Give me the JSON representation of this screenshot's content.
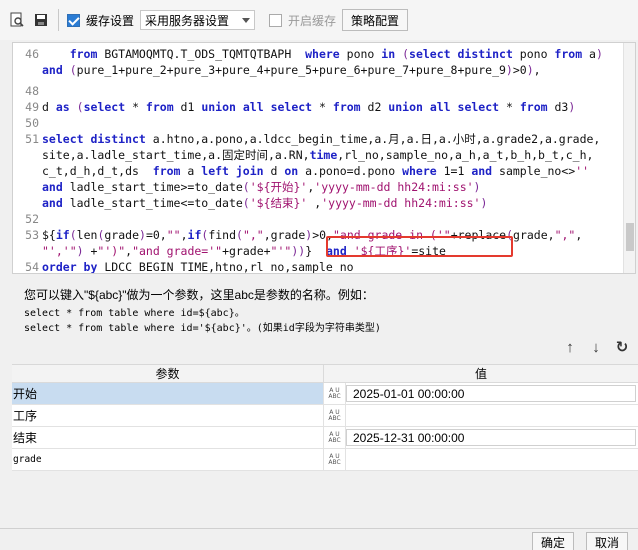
{
  "toolbar": {
    "cache_setting_label": "缓存设置",
    "cache_select_value": "采用服务器设置",
    "enable_cache_label": "开启缓存",
    "strategy_button": "策略配置"
  },
  "editor": {
    "lines": [
      {
        "no": "46",
        "text": "    from BGTAMOQMTQ.T_ODS_TQMTQTBAPH  where pono in (select distinct pono from a)"
      },
      {
        "no": "",
        "text": "and (pure_1+pure_2+pure_3+pure_4+pure_5+pure_6+pure_7+pure_8+pure_9)>0),"
      },
      {
        "no": "48",
        "text": ""
      },
      {
        "no": "49",
        "text": "d as (select * from d1 union all select * from d2 union all select * from d3)"
      },
      {
        "no": "50",
        "text": ""
      },
      {
        "no": "51",
        "text": "select distinct a.htno,a.pono,a.ldcc_begin_time,a.月,a.日,a.小时,a.grade2,a.grade,"
      },
      {
        "no": "",
        "text": "site,a.ladle_start_time,a.固定时间,a.RN,time,rl_no,sample_no,a_h,a_t,b_h,b_t,c_h,"
      },
      {
        "no": "",
        "text": "c_t,d_h,d_t,ds  from a left join d on a.pono=d.pono where 1=1 and sample_no<>''"
      },
      {
        "no": "",
        "text": "and ladle_start_time>=to_date('${开始}','yyyy-mm-dd hh24:mi:ss')"
      },
      {
        "no": "",
        "text": "and ladle_start_time<=to_date('${结束}' ,'yyyy-mm-dd hh24:mi:ss')"
      },
      {
        "no": "52",
        "text": ""
      },
      {
        "no": "53",
        "text": "${if(len(grade)=0,\"\",if(find(\",\",grade)>0,\"and grade in ('\"+replace(grade,\",\","
      },
      {
        "no": "",
        "text": "\"','\") +\"')\",\"and grade='\"+grade+\"'\"))}  and '${工序}'=site"
      },
      {
        "no": "54",
        "text": "order by LDCC_BEGIN_TIME,htno,rl_no,sample_no"
      }
    ]
  },
  "hint": {
    "line1": "您可以键入\"${abc}\"做为一个参数，这里abc是参数的名称。例如：",
    "line2": "select * from table where id=${abc}。",
    "line3": "select * from table where id='${abc}'。(如果id字段为字符串类型)"
  },
  "grid": {
    "header_name": "参数",
    "header_value": "值",
    "rows": [
      {
        "name": "开始",
        "value": "2025-01-01 00:00:00"
      },
      {
        "name": "工序",
        "value": ""
      },
      {
        "name": "结束",
        "value": "2025-12-31 00:00:00"
      },
      {
        "name": "grade",
        "value": ""
      }
    ],
    "type_badge": "A U ABC"
  },
  "buttons": {
    "ok": "确定",
    "cancel": "取消"
  },
  "colors": {
    "keyword": "#1e22c6",
    "string": "#a0126f",
    "highlight_box": "#e43a2e",
    "selected_row": "#c8dcf0"
  }
}
